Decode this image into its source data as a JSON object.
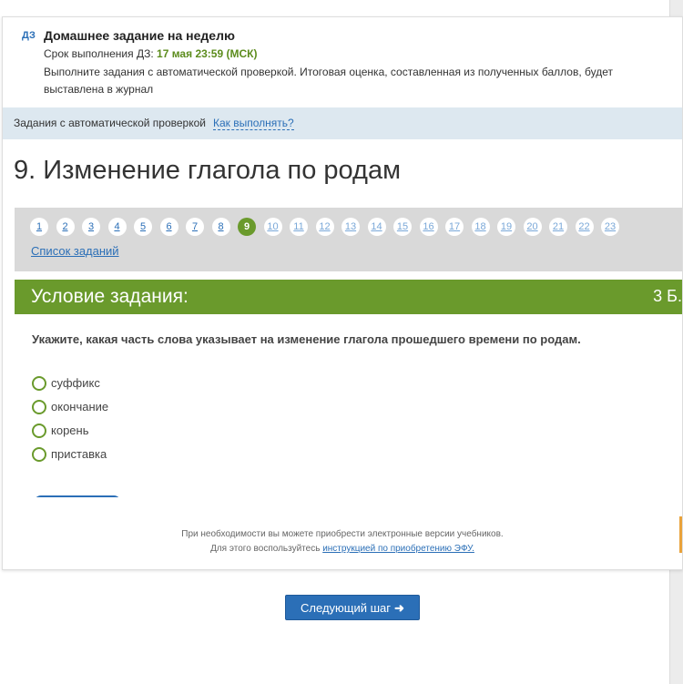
{
  "homework": {
    "tag": "ДЗ",
    "title": "Домашнее задание на неделю",
    "deadline_label": "Срок выполнения ДЗ:",
    "deadline_value": "17 мая 23:59 (МСК)",
    "description": "Выполните задания с автоматической проверкой. Итоговая оценка, составленная из полученных баллов, будет выставлена в журнал"
  },
  "auto_check": {
    "label": "Задания с автоматической проверкой",
    "how_link": "Как выполнять?"
  },
  "task": {
    "title": "9. Изменение глагола по родам"
  },
  "navigation": {
    "numbers": [
      "1",
      "2",
      "3",
      "4",
      "5",
      "6",
      "7",
      "8",
      "9",
      "10",
      "11",
      "12",
      "13",
      "14",
      "15",
      "16",
      "17",
      "18",
      "19",
      "20",
      "21",
      "22",
      "23"
    ],
    "active": "9",
    "list_link": "Список заданий"
  },
  "condition": {
    "label": "Условие задания:",
    "points": "3 Б."
  },
  "question": {
    "text": "Укажите, какая часть слова указывает на изменение глагола прошедшего времени по родам.",
    "options": [
      "суффикс",
      "окончание",
      "корень",
      "приставка"
    ]
  },
  "footer": {
    "line1": "При необходимости вы можете приобрести электронные версии учебников.",
    "line2_prefix": "Для этого воспользуйтесь",
    "line2_link": "инструкцией по приобретению ЭФУ."
  },
  "next_button": {
    "label": "Следующий шаг",
    "icon": "arrow-right-icon"
  },
  "colors": {
    "accent_green": "#6a9a2c",
    "link_blue": "#2b6fb7",
    "info_bar": "#dde8f0"
  }
}
